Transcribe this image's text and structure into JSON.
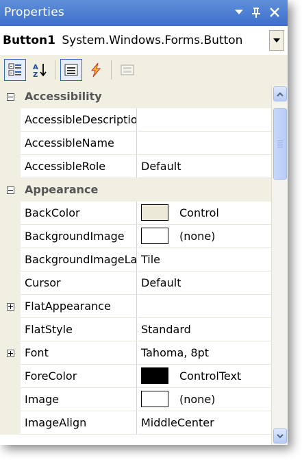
{
  "window": {
    "title": "Properties"
  },
  "object_selector": {
    "name": "Button1",
    "type": "System.Windows.Forms.Button"
  },
  "toolbar": {
    "items": [
      {
        "name": "categorized-button",
        "icon": "categorized-icon",
        "pressed": true
      },
      {
        "name": "alphabetical-button",
        "icon": "sort-az-icon",
        "pressed": false
      },
      {
        "name": "properties-button",
        "icon": "properties-list-icon",
        "pressed": true
      },
      {
        "name": "events-button",
        "icon": "lightning-icon",
        "pressed": false
      },
      {
        "name": "property-pages-button",
        "icon": "property-pages-icon",
        "pressed": false
      }
    ]
  },
  "grid": {
    "rows": [
      {
        "kind": "category",
        "name": "Accessibility"
      },
      {
        "kind": "property",
        "name": "AccessibleDescription",
        "value": ""
      },
      {
        "kind": "property",
        "name": "AccessibleName",
        "value": ""
      },
      {
        "kind": "property",
        "name": "AccessibleRole",
        "value": "Default"
      },
      {
        "kind": "category",
        "name": "Appearance"
      },
      {
        "kind": "property",
        "name": "BackColor",
        "value": "Control",
        "swatch": "#ece9d8"
      },
      {
        "kind": "property",
        "name": "BackgroundImage",
        "value": "(none)",
        "swatch": "#ffffff"
      },
      {
        "kind": "property",
        "name": "BackgroundImageLayout",
        "value": "Tile"
      },
      {
        "kind": "property",
        "name": "Cursor",
        "value": "Default"
      },
      {
        "kind": "property",
        "name": "FlatAppearance",
        "value": "",
        "expandable": true
      },
      {
        "kind": "property",
        "name": "FlatStyle",
        "value": "Standard"
      },
      {
        "kind": "property",
        "name": "Font",
        "value": "Tahoma, 8pt",
        "expandable": true
      },
      {
        "kind": "property",
        "name": "ForeColor",
        "value": "ControlText",
        "swatch": "#000000"
      },
      {
        "kind": "property",
        "name": "Image",
        "value": "(none)",
        "swatch": "#ffffff"
      },
      {
        "kind": "property",
        "name": "ImageAlign",
        "value": "MiddleCenter"
      }
    ]
  },
  "colors": {
    "title_bar": "#4a7bd0",
    "gutter": "#f1efe2",
    "scroll_thumb": "#c1d3fb"
  }
}
